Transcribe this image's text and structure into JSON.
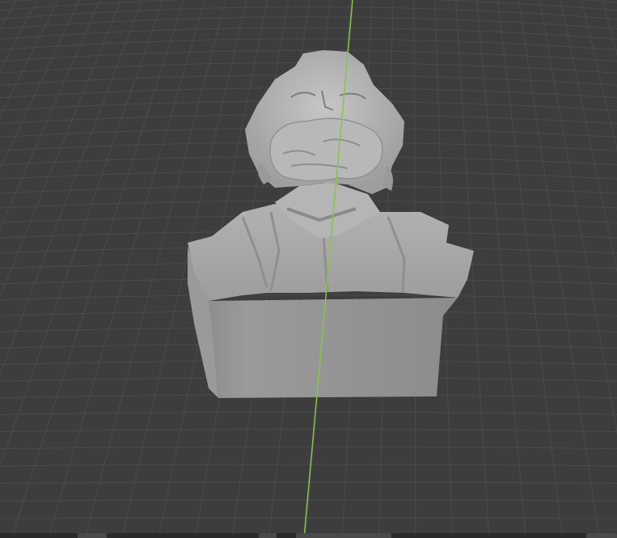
{
  "viewport": {
    "background_color": "#3d3d3d",
    "grid_color": "#4b4b4b",
    "y_axis_color": "#8bc34a",
    "model": {
      "name": "bust",
      "color": "#a9a9a9",
      "shadow_color": "#8a8a8a",
      "highlight_color": "#c3c3c3"
    }
  },
  "bottom_bar": {
    "visible_tabs": 3
  }
}
